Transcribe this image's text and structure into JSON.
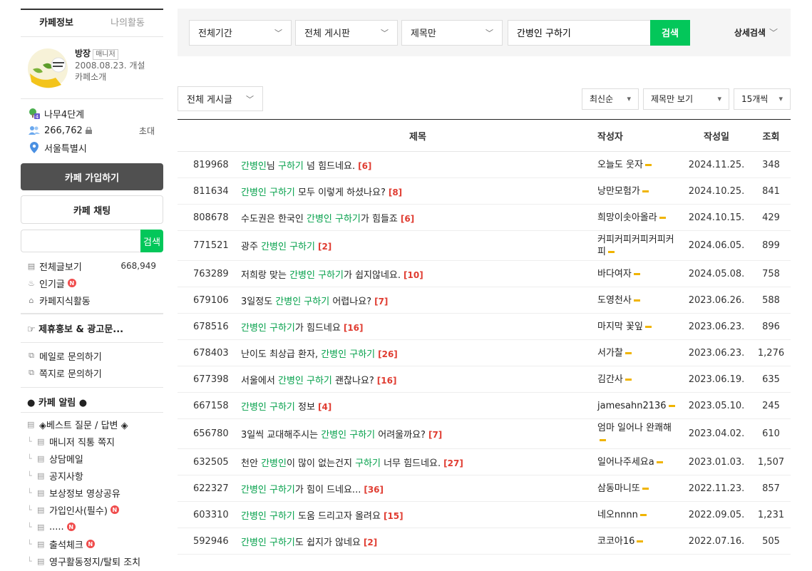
{
  "sidebar": {
    "tabs": [
      "카페정보",
      "나의활동"
    ],
    "manager_name": "방장",
    "manager_badge": "매니저",
    "founded": "2008.08.23. 개설",
    "cafe_intro": "카페소개",
    "level": "나무4단계",
    "members": "266,762",
    "invite": "초대",
    "location": "서울특별시",
    "join_button": "카페 가입하기",
    "chat_button": "카페 채팅",
    "search_button": "검색",
    "search_placeholder": "",
    "menu_all": "전체글보기",
    "menu_all_count": "668,949",
    "menu_popular": "인기글",
    "menu_knowledge": "카페지식활동",
    "promo_title": "☞ 제휴홍보 & 광고문...",
    "contact_mail": "메일로 문의하기",
    "contact_note": "쪽지로 문의하기",
    "notice_title": "● 카페 알림 ●",
    "board_items": [
      {
        "label": "◈베스트 질문 / 답변 ◈",
        "child": false,
        "new": false
      },
      {
        "label": "매니저 직통 쪽지",
        "child": true,
        "new": false
      },
      {
        "label": "상담메일",
        "child": true,
        "new": false
      },
      {
        "label": "공지사항",
        "child": true,
        "new": false
      },
      {
        "label": "보상정보 영상공유",
        "child": true,
        "new": false
      },
      {
        "label": "가입인사(필수)",
        "child": true,
        "new": true
      },
      {
        "label": ".....",
        "child": true,
        "new": true
      },
      {
        "label": "출석체크",
        "child": true,
        "new": true
      },
      {
        "label": "영구활동정지/탈퇴 조치",
        "child": true,
        "new": false
      }
    ]
  },
  "filter": {
    "period": "전체기간",
    "board": "전체 게시판",
    "scope": "제목만",
    "query": "간병인 구하기",
    "search_button": "검색",
    "detail_search": "상세검색"
  },
  "toolbar": {
    "board_select": "전체 게시글",
    "sort": "최신순",
    "view": "제목만 보기",
    "per_page": "15개씩"
  },
  "table": {
    "headers": {
      "title": "제목",
      "author": "작성자",
      "date": "작성일",
      "views": "조회"
    },
    "rows": [
      {
        "num": "819968",
        "title": [
          [
            "간병인",
            "hl"
          ],
          [
            "님 ",
            ""
          ],
          [
            "구하기",
            "hl"
          ],
          [
            " 넘 힘드네요.",
            ""
          ]
        ],
        "comments": "[6]",
        "author": "오늘도 웃자",
        "date": "2024.11.25.",
        "views": "348"
      },
      {
        "num": "811634",
        "title": [
          [
            "간병인 구하기",
            "hl"
          ],
          [
            " 모두 이렇게 하셨나요?",
            ""
          ]
        ],
        "comments": "[8]",
        "author": "낭만모험가",
        "date": "2024.10.25.",
        "views": "841"
      },
      {
        "num": "808678",
        "title": [
          [
            "수도권은 한국인 ",
            ""
          ],
          [
            "간병인 구하기",
            "hl"
          ],
          [
            "가 힘들죠",
            ""
          ]
        ],
        "comments": "[6]",
        "author": "희망이솟아올라",
        "date": "2024.10.15.",
        "views": "429"
      },
      {
        "num": "771521",
        "title": [
          [
            "광주 ",
            ""
          ],
          [
            "간병인 구하기",
            "hl"
          ]
        ],
        "comments": "[2]",
        "author": "커피커피커피커피커피",
        "date": "2024.06.05.",
        "views": "899",
        "tall": true
      },
      {
        "num": "763289",
        "title": [
          [
            "저희랑 맞는 ",
            ""
          ],
          [
            "간병인 구하기",
            "hl"
          ],
          [
            "가 쉽지않네요.",
            ""
          ]
        ],
        "comments": "[10]",
        "author": "바다여자",
        "date": "2024.05.08.",
        "views": "758"
      },
      {
        "num": "679106",
        "title": [
          [
            "3일정도 ",
            ""
          ],
          [
            "간병인 구하기",
            "hl"
          ],
          [
            " 어렵나요?",
            ""
          ]
        ],
        "comments": "[7]",
        "author": "도영천사",
        "date": "2023.06.26.",
        "views": "588"
      },
      {
        "num": "678516",
        "title": [
          [
            "간병인 구하기",
            "hl"
          ],
          [
            "가 힘드네요",
            ""
          ]
        ],
        "comments": "[16]",
        "author": "마지막 꽃잎",
        "date": "2023.06.23.",
        "views": "896"
      },
      {
        "num": "678403",
        "title": [
          [
            "난이도 최상급 환자, ",
            ""
          ],
          [
            "간병인 구하기",
            "hl"
          ]
        ],
        "comments": "[26]",
        "author": "서가찰",
        "date": "2023.06.23.",
        "views": "1,276"
      },
      {
        "num": "677398",
        "title": [
          [
            "서울에서 ",
            ""
          ],
          [
            "간병인 구하기",
            "hl"
          ],
          [
            " 괜찮나요?",
            ""
          ]
        ],
        "comments": "[16]",
        "author": "김간사",
        "date": "2023.06.19.",
        "views": "635"
      },
      {
        "num": "667158",
        "title": [
          [
            "간병인 구하기",
            "hl"
          ],
          [
            " 정보",
            ""
          ]
        ],
        "comments": "[4]",
        "author": "jamesahn2136",
        "date": "2023.05.10.",
        "views": "245"
      },
      {
        "num": "656780",
        "title": [
          [
            "3일씩 교대해주시는 ",
            ""
          ],
          [
            "간병인 구하기",
            "hl"
          ],
          [
            " 어려울까요?",
            ""
          ]
        ],
        "comments": "[7]",
        "author": "엄마 일어나 완쾌해",
        "date": "2023.04.02.",
        "views": "610",
        "tall": true
      },
      {
        "num": "632505",
        "title": [
          [
            "천안 ",
            ""
          ],
          [
            "간병인",
            "hl"
          ],
          [
            "이 많이 없는건지 ",
            ""
          ],
          [
            "구하기",
            "hl"
          ],
          [
            " 너무 힘드네요.",
            ""
          ]
        ],
        "comments": "[27]",
        "author": "일어나주세요a",
        "date": "2023.01.03.",
        "views": "1,507"
      },
      {
        "num": "622327",
        "title": [
          [
            "간병인 구하기",
            "hl"
          ],
          [
            "가 힘이 드네요...",
            ""
          ]
        ],
        "comments": "[36]",
        "author": "삼동마니또",
        "date": "2022.11.23.",
        "views": "857"
      },
      {
        "num": "603310",
        "title": [
          [
            "간병인 구하기",
            "hl"
          ],
          [
            " 도움 드리고자 올려요",
            ""
          ]
        ],
        "comments": "[15]",
        "author": "네오nnnn",
        "date": "2022.09.05.",
        "views": "1,231"
      },
      {
        "num": "592946",
        "title": [
          [
            "간병인 구하기",
            "hl"
          ],
          [
            "도 쉽지가 않네요",
            ""
          ]
        ],
        "comments": "[2]",
        "author": "코코아16",
        "date": "2022.07.16.",
        "views": "505"
      }
    ]
  },
  "colors": {
    "accent_green": "#03c75a",
    "highlight_text": "#03a04a",
    "comment_red": "#e03c31",
    "new_badge": "#f04c4c",
    "join_button": "#505050"
  },
  "icons": [
    "chevron-down-icon",
    "tree-level-icon",
    "members-icon",
    "lock-icon",
    "location-pin-icon",
    "board-doc-icon",
    "popular-fire-icon",
    "knowledge-cap-icon",
    "external-link-icon"
  ]
}
